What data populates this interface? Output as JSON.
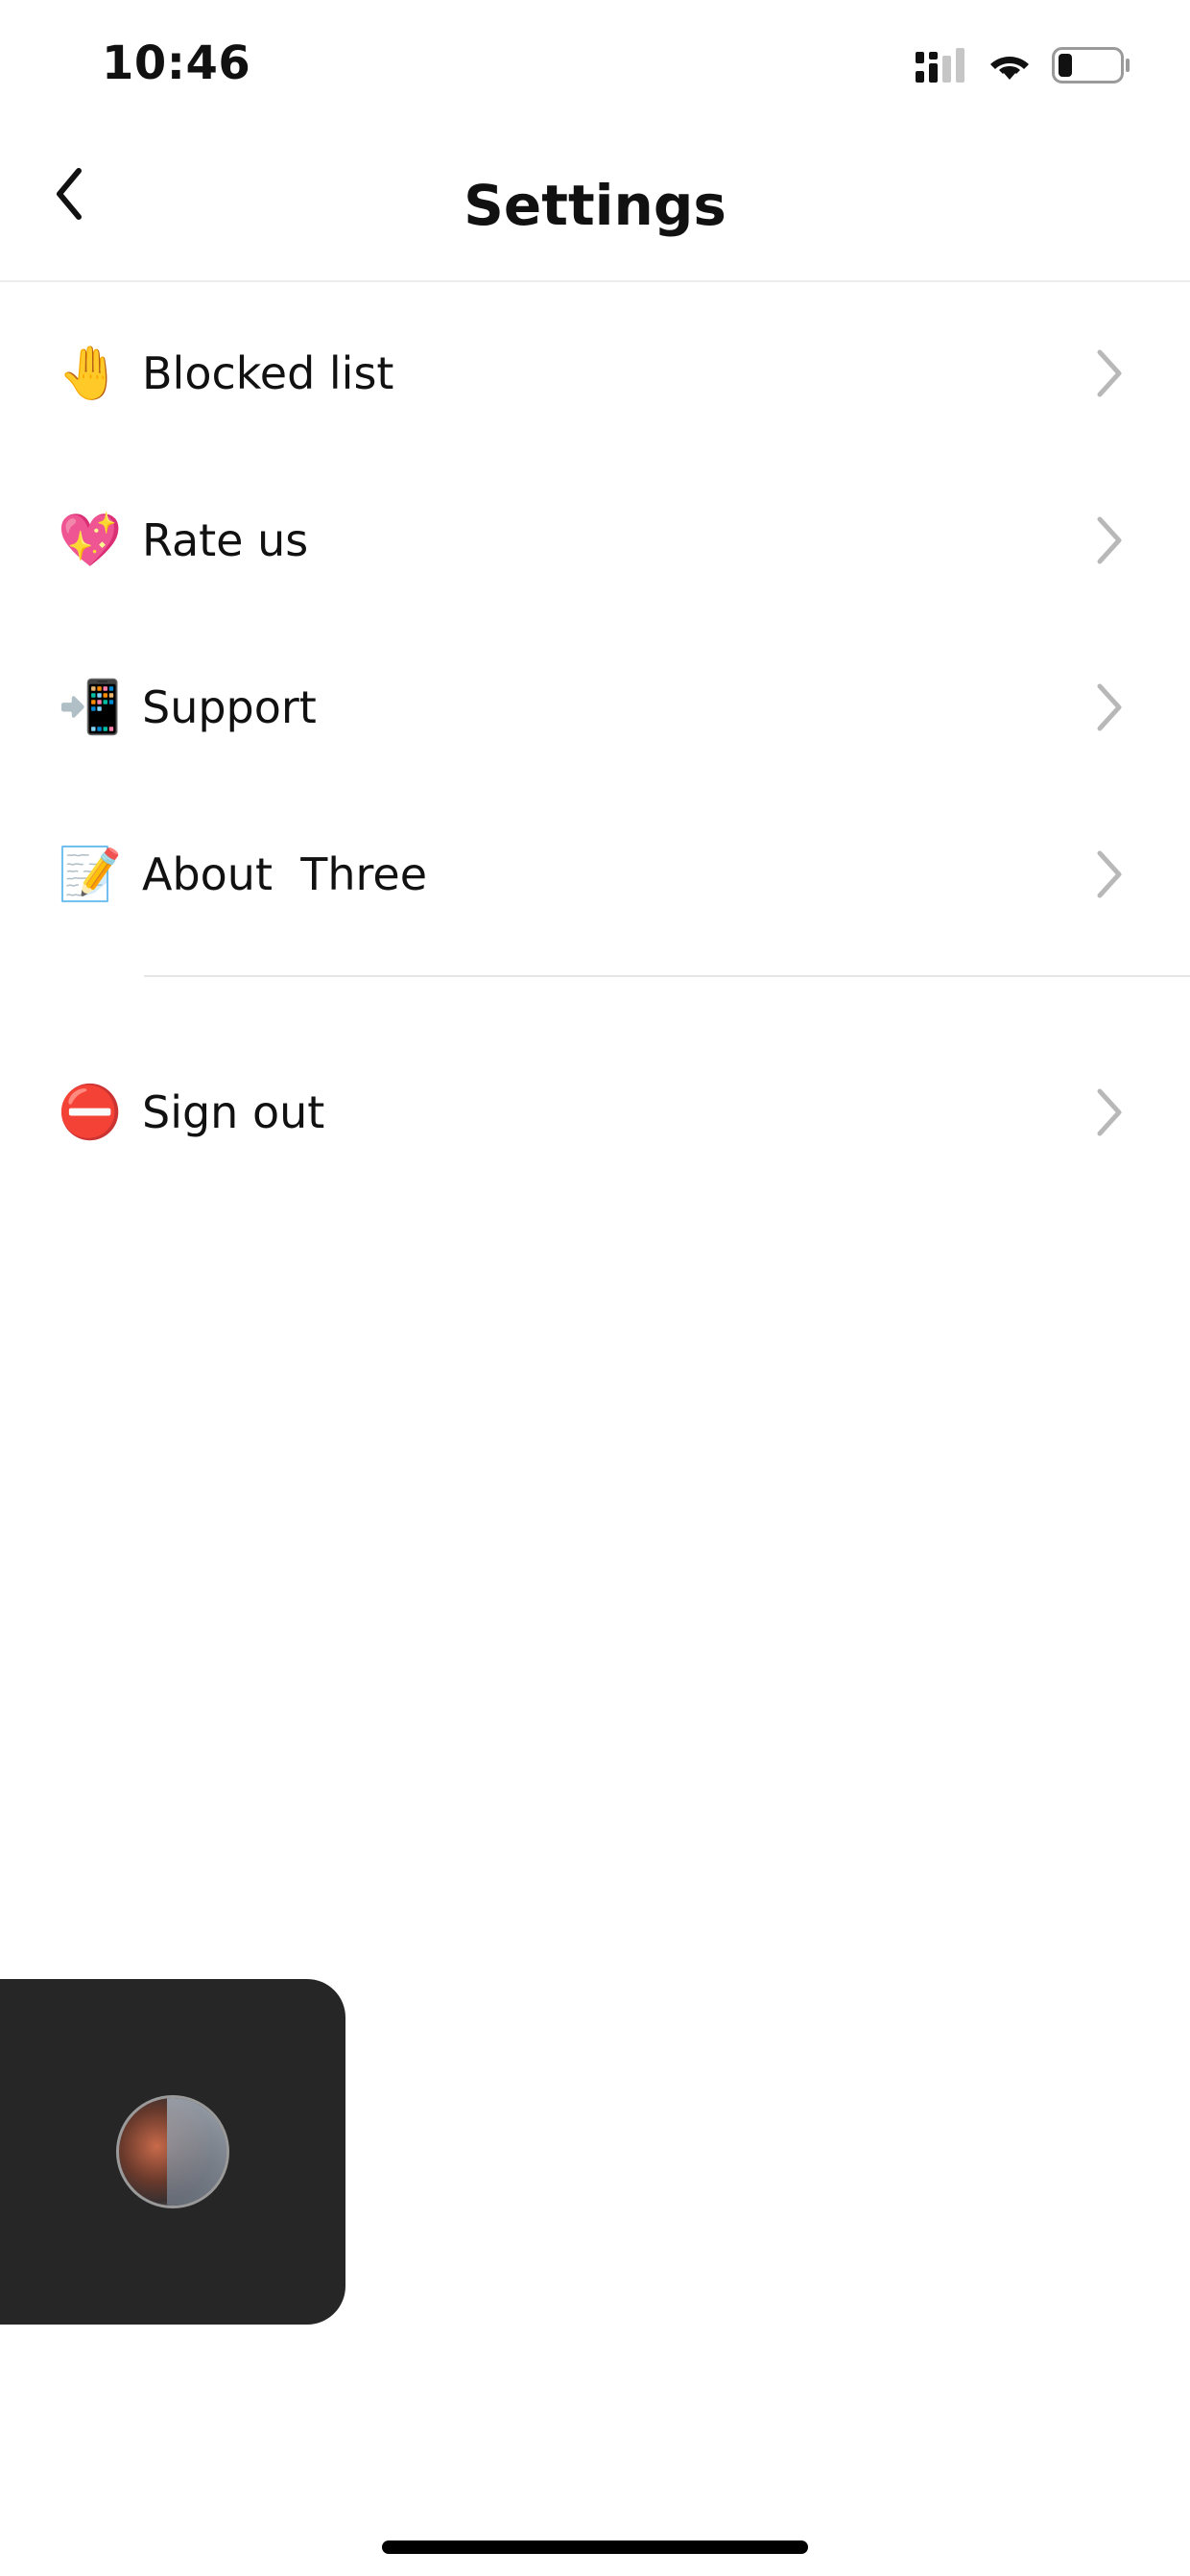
{
  "status_bar": {
    "time": "10:46",
    "icons": [
      "cellular-signal-icon",
      "wifi-icon",
      "battery-icon"
    ]
  },
  "header": {
    "title": "Settings",
    "back_icon": "chevron-left-icon"
  },
  "settings": {
    "items": [
      {
        "emoji": "🤚",
        "icon": "raised-hand-icon",
        "label": "Blocked list"
      },
      {
        "emoji": "💖",
        "icon": "sparkling-heart-icon",
        "label": "Rate us"
      },
      {
        "emoji": "📲",
        "icon": "mobile-phone-arrow-icon",
        "label": "Support"
      },
      {
        "emoji": "📝",
        "icon": "memo-icon",
        "label": "About  Three"
      }
    ],
    "sign_out": {
      "emoji": "⛔",
      "icon": "no-entry-icon",
      "label": "Sign out"
    }
  },
  "mini_player": {
    "icon": "avatar-thumbnail"
  },
  "colors": {
    "background": "#ffffff",
    "text": "#111111",
    "chevron": "#b8b8b8",
    "divider": "#e6e6e6",
    "mini_player_bg": "#262626"
  }
}
